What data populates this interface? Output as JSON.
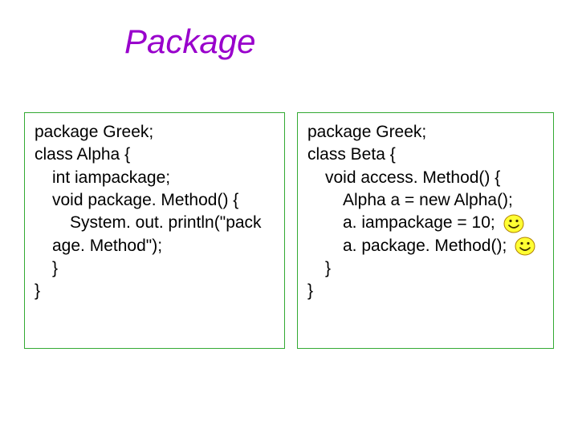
{
  "title": "Package",
  "left": {
    "l1": "package Greek;",
    "l2": "class Alpha {",
    "l3": "int iampackage;",
    "l4": "void package. Method() {",
    "l5": "System. out. println(\"pack",
    "l6": "age. Method\");",
    "l7": "}",
    "l8": "}"
  },
  "right": {
    "l1": "package Greek;",
    "l2": "class Beta {",
    "l3": "void access. Method() {",
    "l4": "Alpha a = new Alpha();",
    "l5": "a. iampackage = 10;",
    "l6": "a. package. Method();",
    "l7": "}",
    "l8": "}"
  }
}
